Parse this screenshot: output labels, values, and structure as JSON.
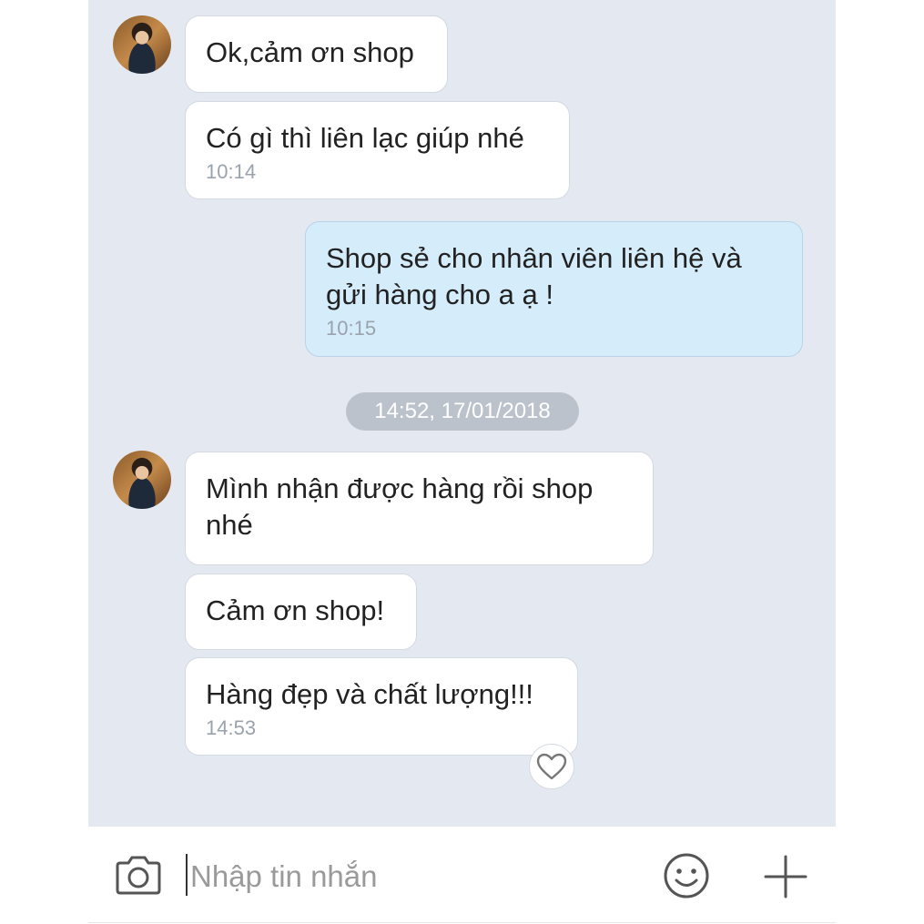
{
  "conversation": {
    "messages": [
      {
        "side": "received",
        "text": "Ok,cảm ơn shop",
        "time": ""
      },
      {
        "side": "received",
        "text": "Có gì thì liên lạc giúp nhé",
        "time": "10:14"
      },
      {
        "side": "sent",
        "text": "Shop sẻ cho nhân viên liên hệ và\ngửi hàng cho a ạ !",
        "time": "10:15"
      },
      {
        "side": "received",
        "text": "Mình nhận được hàng rồi shop\nnhé",
        "time": ""
      },
      {
        "side": "received",
        "text": "Cảm ơn shop!",
        "time": ""
      },
      {
        "side": "received",
        "text": "Hàng đẹp và chất lượng!!!",
        "time": "14:53"
      }
    ],
    "date_separator": "14:52, 17/01/2018"
  },
  "composer": {
    "placeholder": "Nhập tin nhắn",
    "icons": {
      "camera": "camera-icon",
      "emoji": "smiley-icon",
      "add": "plus-icon",
      "reaction": "heart-icon"
    }
  },
  "colors": {
    "chat_background": "#e4e8f0",
    "sent_bubble": "#d5ecfb",
    "received_bubble": "#ffffff",
    "date_pill": "#bcc2cb"
  }
}
